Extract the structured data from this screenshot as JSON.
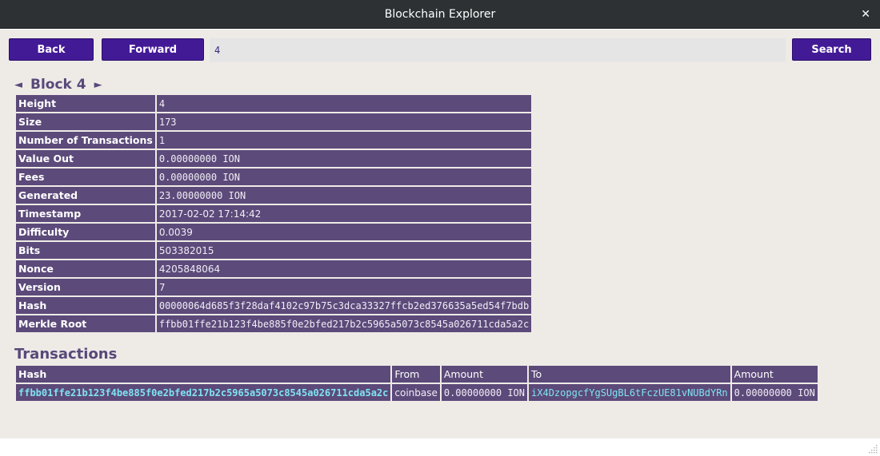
{
  "window": {
    "title": "Blockchain Explorer",
    "close_glyph": "✕"
  },
  "toolbar": {
    "back_label": "Back",
    "forward_label": "Forward",
    "search_value": "4",
    "search_label": "Search"
  },
  "block": {
    "prev_glyph": "◄",
    "title": "Block 4",
    "next_glyph": "►",
    "fields": [
      {
        "key": "Height",
        "value": "4"
      },
      {
        "key": "Size",
        "value": "173"
      },
      {
        "key": "Number of Transactions",
        "value": "1"
      },
      {
        "key": "Value Out",
        "value": "0.00000000 ION"
      },
      {
        "key": "Fees",
        "value": "0.00000000 ION"
      },
      {
        "key": "Generated",
        "value": "23.00000000 ION"
      },
      {
        "key": "Timestamp",
        "value": "2017-02-02 17:14:42"
      },
      {
        "key": "Difficulty",
        "value": "0.0039"
      },
      {
        "key": "Bits",
        "value": "503382015"
      },
      {
        "key": "Nonce",
        "value": "4205848064"
      },
      {
        "key": "Version",
        "value": "7"
      },
      {
        "key": "Hash",
        "value": "00000064d685f3f28daf4102c97b75c3dca33327ffcb2ed376635a5ed54f7bdb"
      },
      {
        "key": "Merkle Root",
        "value": "ffbb01ffe21b123f4be885f0e2bfed217b2c5965a5073c8545a026711cda5a2c"
      }
    ]
  },
  "transactions": {
    "title": "Transactions",
    "headers": [
      "Hash",
      "From",
      "Amount",
      "To",
      "Amount"
    ],
    "rows": [
      {
        "hash": "ffbb01ffe21b123f4be885f0e2bfed217b2c5965a5073c8545a026711cda5a2c",
        "from": "coinbase",
        "amount_in": "0.00000000 ION",
        "to": "iX4DzopgcfYgSUgBL6tFczUE81vNUBdYRn",
        "amount_out": "0.00000000 ION"
      }
    ]
  },
  "colors": {
    "accent": "#431a96",
    "table_bg": "#5c4a7a",
    "heading": "#58487a",
    "link": "#7fe3f0"
  }
}
